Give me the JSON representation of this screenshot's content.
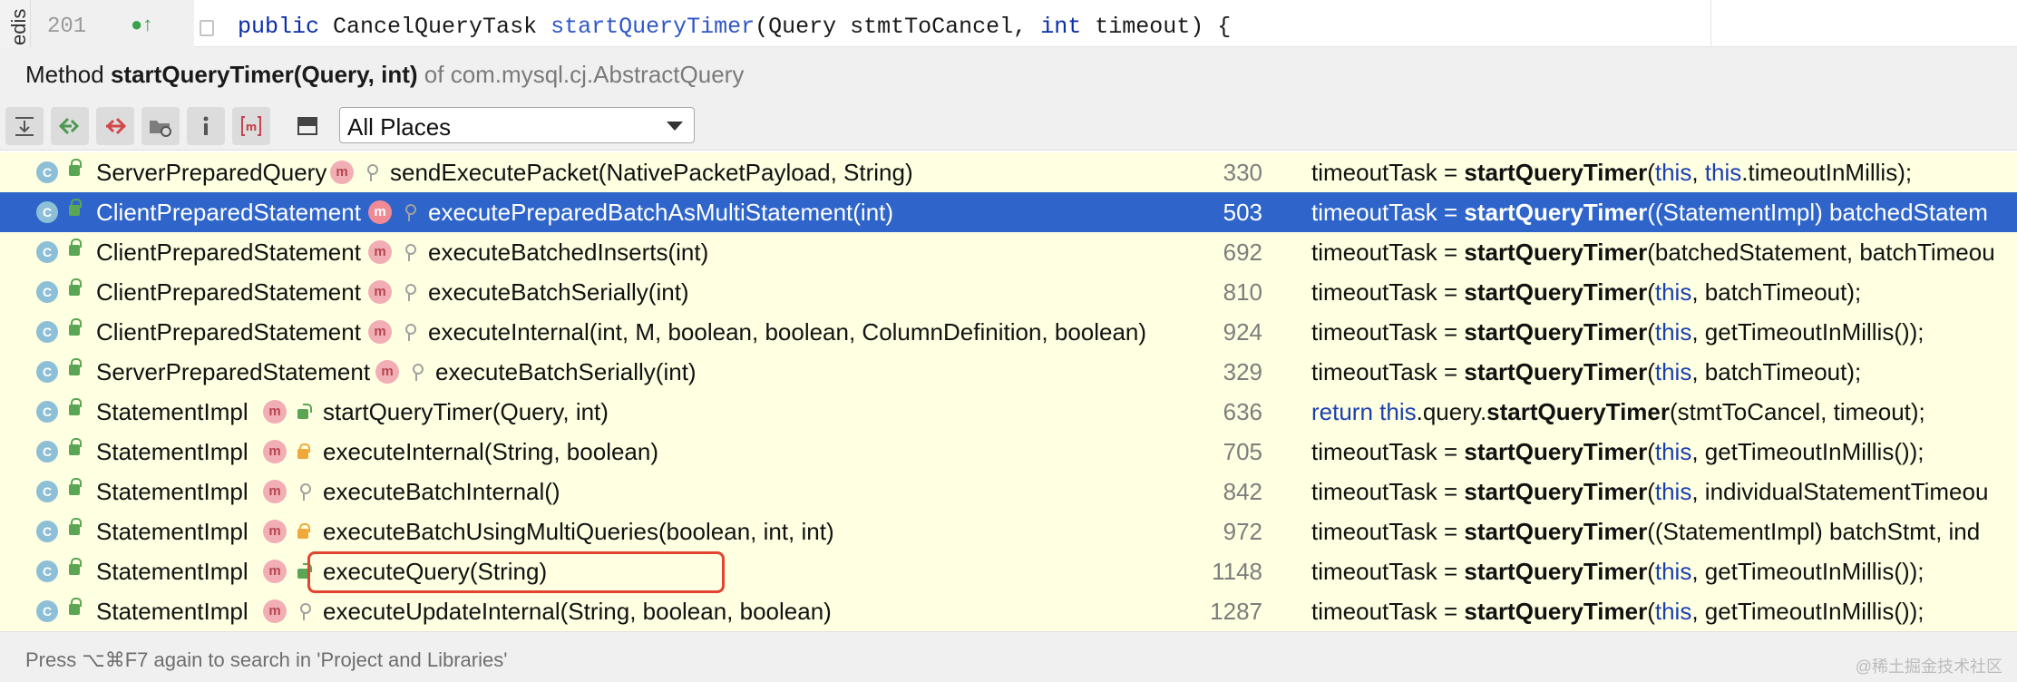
{
  "editor": {
    "side_tab": "edis",
    "line_number": "201",
    "code": {
      "kw1": "public",
      "type": "CancelQueryTask",
      "method": "startQueryTimer",
      "p1": "(Query stmtToCancel, ",
      "kw2": "int",
      "p2": " timeout) {"
    }
  },
  "popup": {
    "prefix": "Method",
    "method_sig": "startQueryTimer(Query, int)",
    "of_text": "of com.mysql.cj.AbstractQuery"
  },
  "toolbar": {
    "scope": "All Places",
    "buttons": [
      "expand-all-icon",
      "previous-occurrence-icon",
      "next-occurrence-icon",
      "group-by-module-icon",
      "info-icon",
      "method-icon",
      "pin-icon"
    ]
  },
  "results": [
    {
      "cls": "ServerPreparedQuery",
      "vis": "pkg",
      "method": "sendExecutePacket(NativePacketPayload, String)",
      "line": "330",
      "c1": "timeoutTask = ",
      "c2": "startQueryTimer",
      "c3": "(",
      "c4": "this",
      "c5": ", ",
      "c6": "this",
      "c7": ".timeoutInMillis);"
    },
    {
      "cls": "ClientPreparedStatement",
      "vis": "pkg",
      "method": "executePreparedBatchAsMultiStatement(int)",
      "line": "503",
      "c1": "timeoutTask = ",
      "c2": "startQueryTimer",
      "c3": "((StatementImpl) batchedStatem",
      "c4": "",
      "c5": "",
      "c6": "",
      "c7": ""
    },
    {
      "cls": "ClientPreparedStatement",
      "vis": "pkg",
      "method": "executeBatchedInserts(int)",
      "line": "692",
      "c1": "timeoutTask = ",
      "c2": "startQueryTimer",
      "c3": "(batchedStatement, batchTimeou",
      "c4": "",
      "c5": "",
      "c6": "",
      "c7": ""
    },
    {
      "cls": "ClientPreparedStatement",
      "vis": "pkg",
      "method": "executeBatchSerially(int)",
      "line": "810",
      "c1": "timeoutTask = ",
      "c2": "startQueryTimer",
      "c3": "(",
      "c4": "this",
      "c5": ", batchTimeout);",
      "c6": "",
      "c7": ""
    },
    {
      "cls": "ClientPreparedStatement",
      "vis": "pkg",
      "method": "executeInternal(int, M, boolean, boolean, ColumnDefinition, boolean)",
      "line": "924",
      "c1": "timeoutTask = ",
      "c2": "startQueryTimer",
      "c3": "(",
      "c4": "this",
      "c5": ", getTimeoutInMillis());",
      "c6": "",
      "c7": ""
    },
    {
      "cls": "ServerPreparedStatement",
      "vis": "pkg",
      "method": "executeBatchSerially(int)",
      "line": "329",
      "c1": "timeoutTask = ",
      "c2": "startQueryTimer",
      "c3": "(",
      "c4": "this",
      "c5": ", batchTimeout);",
      "c6": "",
      "c7": ""
    },
    {
      "cls": "StatementImpl",
      "vis": "pub",
      "method": "startQueryTimer(Query, int)",
      "line": "636",
      "c1": "",
      "c2": "startQueryTimer",
      "c3": "(stmtToCancel, timeout);",
      "c4": "",
      "c5": "",
      "c6": "",
      "c7": "",
      "pre_k": "return this",
      "pre_t": ".query."
    },
    {
      "cls": "StatementImpl",
      "vis": "prot",
      "method": "executeInternal(String, boolean)",
      "line": "705",
      "c1": "timeoutTask = ",
      "c2": "startQueryTimer",
      "c3": "(",
      "c4": "this",
      "c5": ", getTimeoutInMillis());",
      "c6": "",
      "c7": ""
    },
    {
      "cls": "StatementImpl",
      "vis": "pkg",
      "method": "executeBatchInternal()",
      "line": "842",
      "c1": "timeoutTask = ",
      "c2": "startQueryTimer",
      "c3": "(",
      "c4": "this",
      "c5": ", individualStatementTimeou",
      "c6": "",
      "c7": ""
    },
    {
      "cls": "StatementImpl",
      "vis": "prot",
      "method": "executeBatchUsingMultiQueries(boolean, int, int)",
      "line": "972",
      "c1": "timeoutTask = ",
      "c2": "startQueryTimer",
      "c3": "((StatementImpl) batchStmt, ind",
      "c4": "",
      "c5": "",
      "c6": "",
      "c7": ""
    },
    {
      "cls": "StatementImpl",
      "vis": "pub",
      "method": "executeQuery(String)",
      "line": "1148",
      "c1": "timeoutTask = ",
      "c2": "startQueryTimer",
      "c3": "(",
      "c4": "this",
      "c5": ", getTimeoutInMillis());",
      "c6": "",
      "c7": ""
    },
    {
      "cls": "StatementImpl",
      "vis": "pkg",
      "method": "executeUpdateInternal(String, boolean, boolean)",
      "line": "1287",
      "c1": "timeoutTask = ",
      "c2": "startQueryTimer",
      "c3": "(",
      "c4": "this",
      "c5": ", getTimeoutInMillis());",
      "c6": "",
      "c7": ""
    }
  ],
  "selected_index": 1,
  "highlighted_index": 10,
  "footer": {
    "hint": "Press ⌥⌘F7 again to search in 'Project and Libraries'",
    "watermark": "@稀土掘金技术社区"
  },
  "colors": {
    "selection": "#2f65ca",
    "results_bg": "#ffffe2",
    "highlight_border": "#e2442f"
  }
}
